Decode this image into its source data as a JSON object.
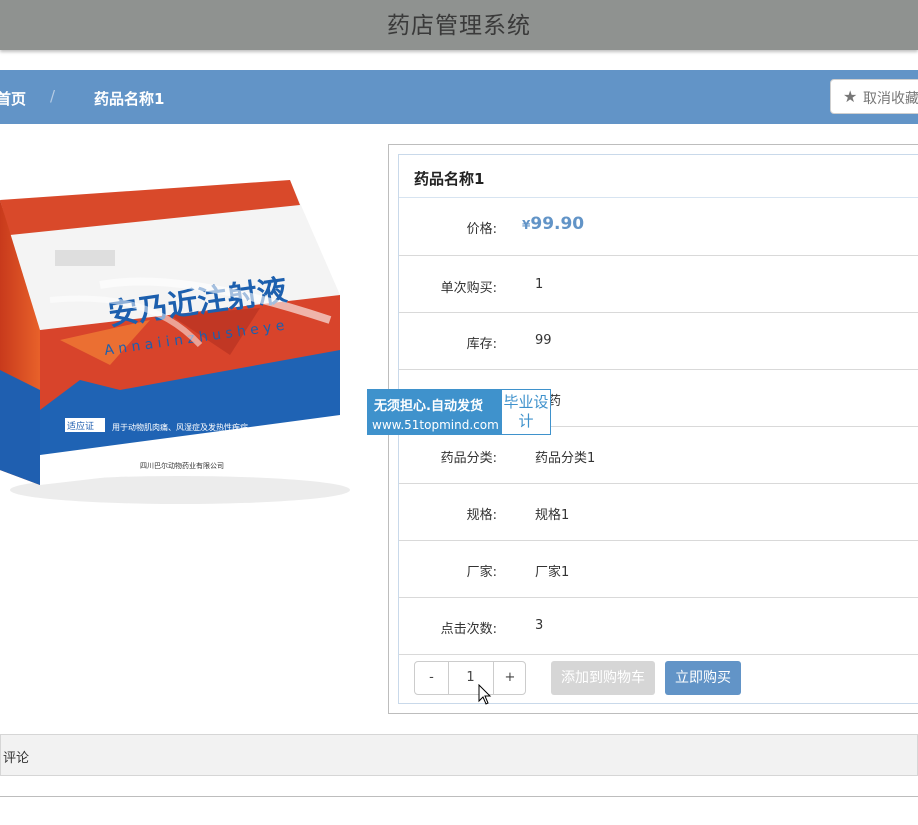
{
  "header": {
    "title": "药店管理系统"
  },
  "breadcrumb": {
    "home": "首页",
    "separator": "/",
    "current": "药品名称1"
  },
  "favorite_button": {
    "label": "取消收藏"
  },
  "product": {
    "name": "药品名称1",
    "fields": [
      {
        "key": "价格:",
        "currency": "¥",
        "value": "99.90"
      },
      {
        "key": "单次购买:",
        "value": "1"
      },
      {
        "key": "库存:",
        "value": "99"
      },
      {
        "key": "",
        "value": "方药"
      },
      {
        "key": "药品分类:",
        "value": "药品分类1"
      },
      {
        "key": "规格:",
        "value": "规格1"
      },
      {
        "key": "厂家:",
        "value": "厂家1"
      },
      {
        "key": "点击次数:",
        "value": "3"
      }
    ]
  },
  "quantity": {
    "minus": "-",
    "value": "1",
    "plus": "+"
  },
  "actions": {
    "add_to_cart": "添加到购物车",
    "buy_now": "立即购买"
  },
  "comments": {
    "label": "评论"
  },
  "watermark": {
    "line1": "无须担心.自动发货",
    "line2": "www.51topmind.com",
    "badge": "毕业设计"
  },
  "colors": {
    "primary": "#6294c7",
    "header_bg": "#8f9290",
    "watermark": "#3f92cc"
  }
}
